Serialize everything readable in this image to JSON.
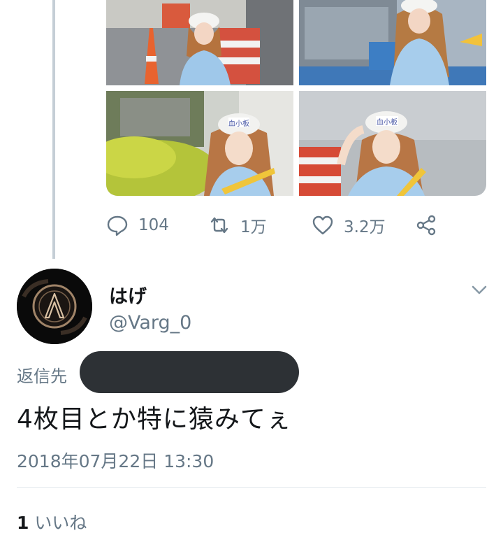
{
  "tweet_media": {
    "photo_1": "photo",
    "photo_2": "photo",
    "photo_3": "photo",
    "photo_4": "photo",
    "cap_text": "血小板"
  },
  "tweet_actions": {
    "reply_count": "104",
    "retweet_count": "1万",
    "like_count": "3.2万",
    "reply_icon": "speech-bubble-icon",
    "retweet_icon": "retweet-icon",
    "like_icon": "heart-icon",
    "share_icon": "share-icon"
  },
  "reply_tweet": {
    "display_name": "はげ",
    "handle": "@Varg_0",
    "reply_to_label": "返信先",
    "text": "4枚目とか特に猿みてぇ",
    "timestamp": "2018年07月22日 13:30",
    "like_count": "1",
    "like_label": "いいね",
    "menu_icon": "chevron-down-icon"
  },
  "colors": {
    "secondary_text": "#657786",
    "primary_text": "#14171a",
    "thread_line": "#c5ced6",
    "divider": "#e1e8ed"
  }
}
